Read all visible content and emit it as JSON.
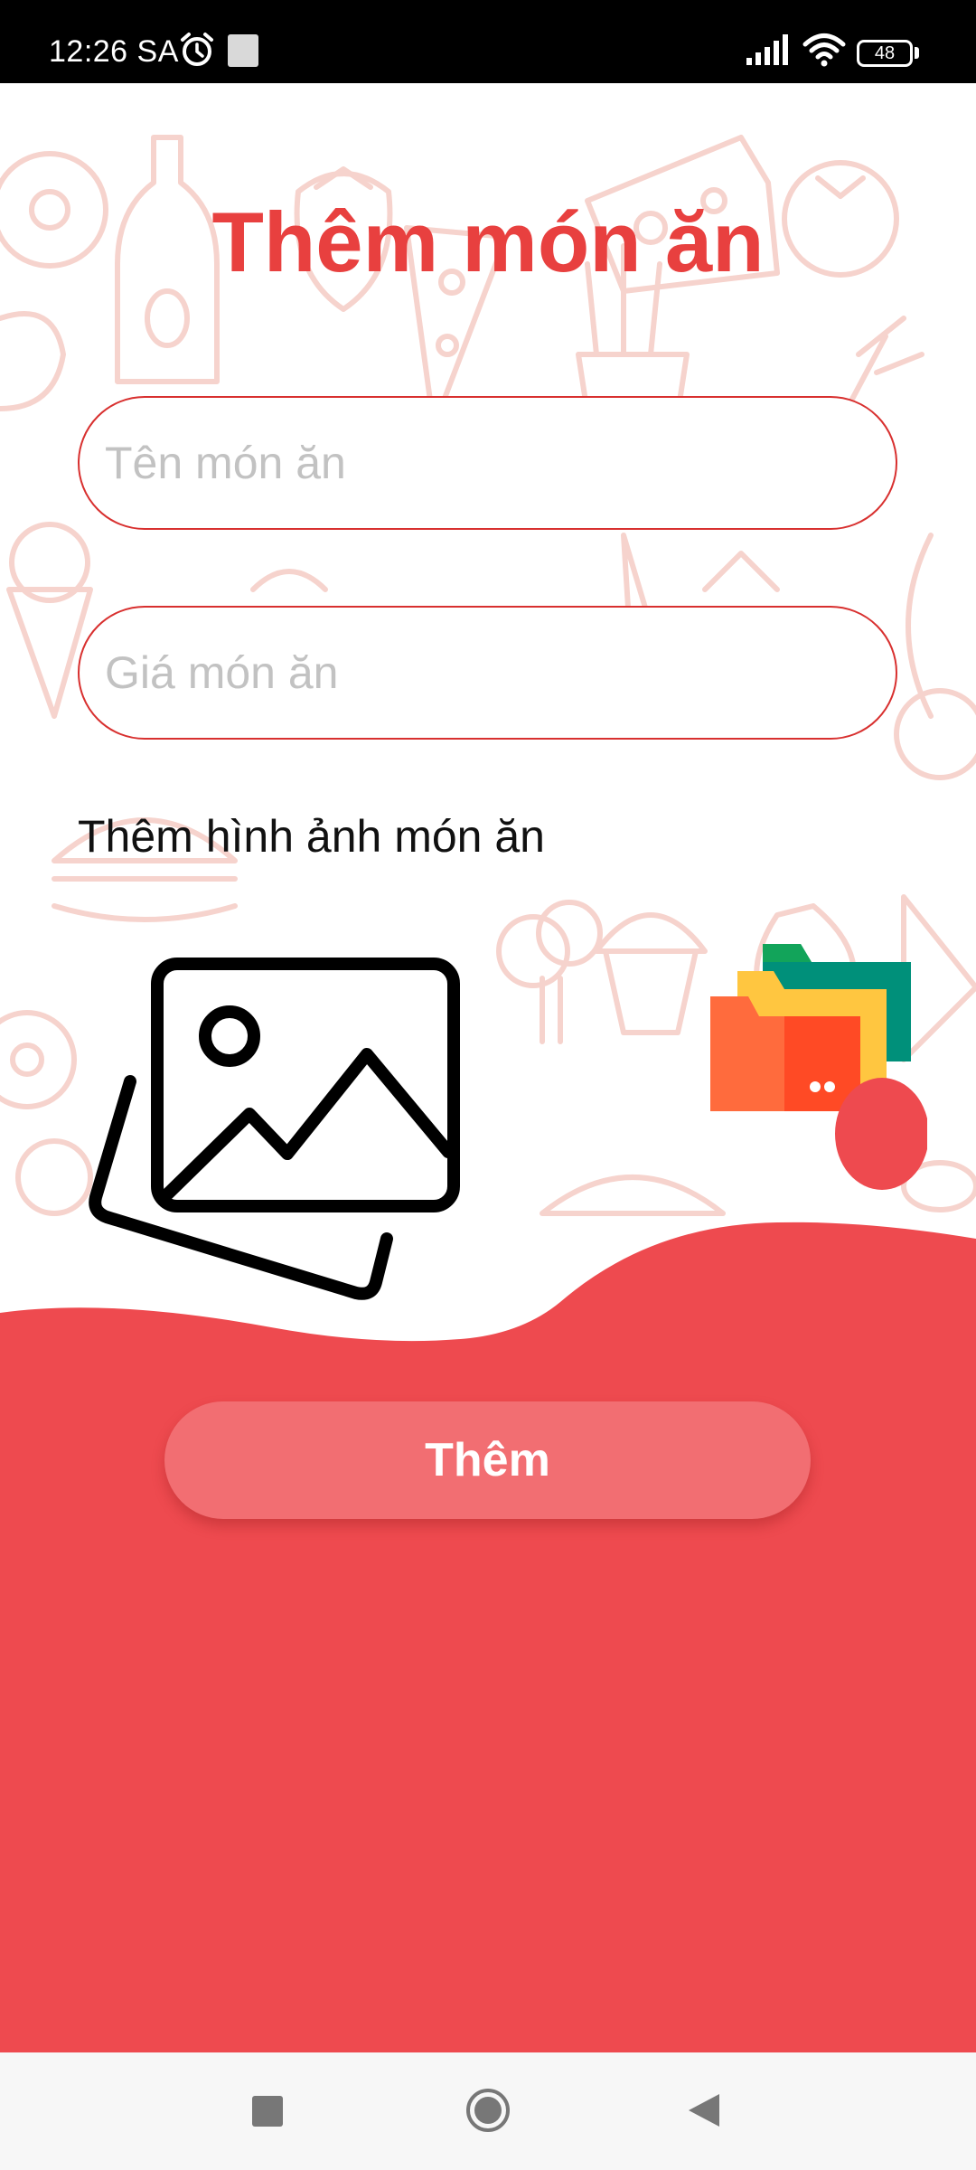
{
  "status_bar": {
    "time": "12:26 SA",
    "battery_level": "48",
    "icons": [
      "alarm-icon",
      "notification-thumbnail",
      "signal-icon",
      "wifi-icon",
      "battery-icon"
    ]
  },
  "header": {
    "title": "Thêm món ăn"
  },
  "form": {
    "name_field": {
      "placeholder": "Tên món ăn",
      "value": ""
    },
    "price_field": {
      "placeholder": "Giá món ăn",
      "value": ""
    },
    "image_label": "Thêm hình ảnh món ăn",
    "image_icons": [
      "gallery-icon",
      "folder-icon"
    ]
  },
  "actions": {
    "submit_label": "Thêm"
  },
  "nav_bar": {
    "buttons": [
      "recents",
      "home",
      "back"
    ]
  },
  "colors": {
    "accent": "#e8403f",
    "bottom_panel": "#ee4a4f",
    "button": "#f26e72",
    "doodle": "#f6d3cd",
    "input_border": "#d8302f"
  }
}
